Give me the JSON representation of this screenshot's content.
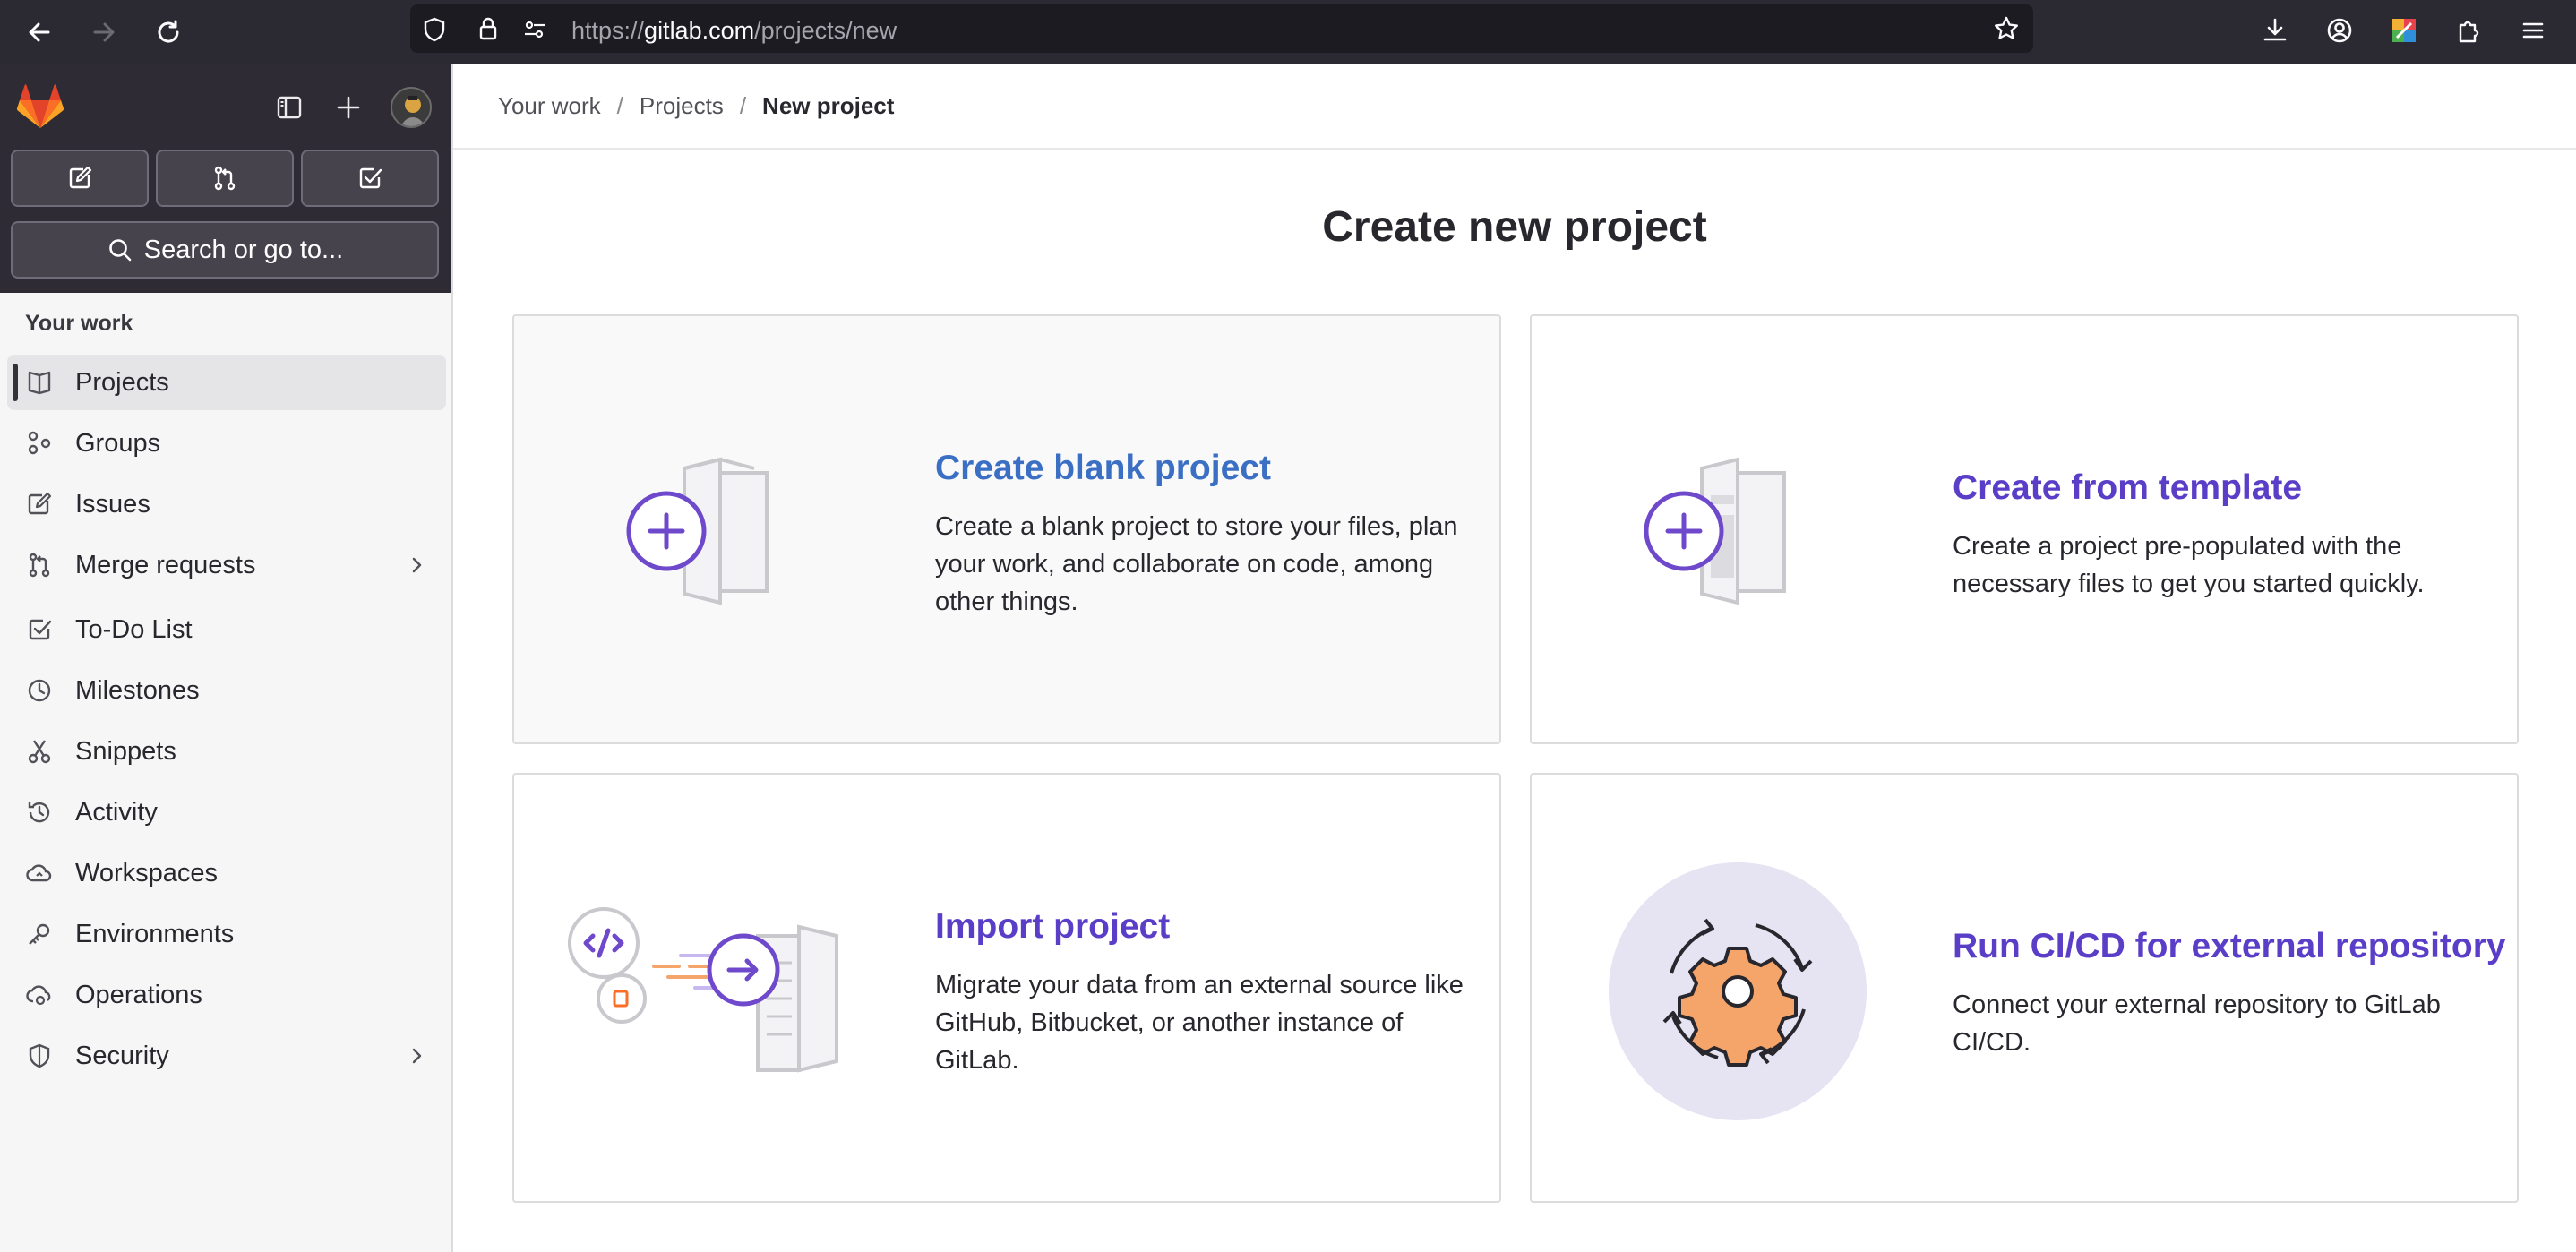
{
  "browser": {
    "url_host_prefix": "https://",
    "url_host": "gitlab.com",
    "url_path": "/projects/new"
  },
  "sidebar": {
    "search_label": "Search or go to...",
    "section_title": "Your work",
    "items": [
      {
        "label": "Projects",
        "icon": "project-icon",
        "active": true
      },
      {
        "label": "Groups",
        "icon": "group-icon"
      },
      {
        "label": "Issues",
        "icon": "issues-icon"
      },
      {
        "label": "Merge requests",
        "icon": "merge-request-icon",
        "expandable": true
      },
      {
        "label": "To-Do List",
        "icon": "todo-icon"
      },
      {
        "label": "Milestones",
        "icon": "clock-icon"
      },
      {
        "label": "Snippets",
        "icon": "snippet-icon"
      },
      {
        "label": "Activity",
        "icon": "history-icon"
      },
      {
        "label": "Workspaces",
        "icon": "cloud-icon"
      },
      {
        "label": "Environments",
        "icon": "environment-icon"
      },
      {
        "label": "Operations",
        "icon": "cloud-gear-icon"
      },
      {
        "label": "Security",
        "icon": "shield-icon",
        "expandable": true
      }
    ]
  },
  "breadcrumb": {
    "items": [
      "Your work",
      "Projects",
      "New project"
    ],
    "separator": "/"
  },
  "main": {
    "title": "Create new project",
    "cards": [
      {
        "title": "Create blank project",
        "description": "Create a blank project to store your files, plan your work, and collaborate on code, among other things."
      },
      {
        "title": "Create from template",
        "description": "Create a project pre-populated with the necessary files to get you started quickly."
      },
      {
        "title": "Import project",
        "description": "Migrate your data from an external source like GitHub, Bitbucket, or another instance of GitLab."
      },
      {
        "title": "Run CI/CD for external repository",
        "description": "Connect your external repository to GitLab CI/CD."
      }
    ]
  },
  "colors": {
    "accent": "#5a3ec8",
    "link_blue": "#3b6fc4",
    "sidebar_dark": "#2f2a3b",
    "gitlab_orange": "#e24329"
  }
}
